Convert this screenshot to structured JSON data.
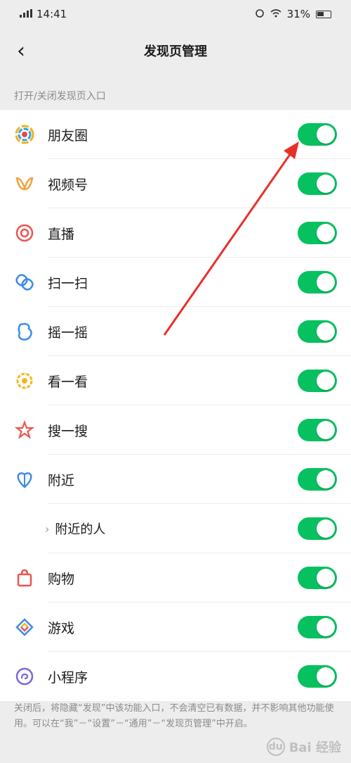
{
  "status_bar": {
    "time": "14:41",
    "battery": "31%"
  },
  "nav": {
    "back_glyph": "‹",
    "title": "发现页管理"
  },
  "caption": "打开/关闭发现页入口",
  "items": [
    {
      "label": "朋友圈",
      "icon": "moments-icon",
      "enabled": true
    },
    {
      "label": "视频号",
      "icon": "channels-icon",
      "enabled": true
    },
    {
      "label": "直播",
      "icon": "live-icon",
      "enabled": true
    },
    {
      "label": "扫一扫",
      "icon": "scan-icon",
      "enabled": true
    },
    {
      "label": "摇一摇",
      "icon": "shake-icon",
      "enabled": true
    },
    {
      "label": "看一看",
      "icon": "top-stories-icon",
      "enabled": true
    },
    {
      "label": "搜一搜",
      "icon": "search-icon",
      "enabled": true
    },
    {
      "label": "附近",
      "icon": "nearby-icon",
      "enabled": true
    },
    {
      "label": "附近的人",
      "icon": "",
      "enabled": true,
      "sub": true
    },
    {
      "label": "购物",
      "icon": "shopping-icon",
      "enabled": true
    },
    {
      "label": "游戏",
      "icon": "games-icon",
      "enabled": true
    },
    {
      "label": "小程序",
      "icon": "mini-programs-icon",
      "enabled": true
    }
  ],
  "footer_note": "关闭后，将隐藏“发现”中该功能入口，不会清空已有数据，并不影响其他功能使用。可以在“我”－“设置”－“通用”－“发现页管理”中开启。",
  "watermark": {
    "text": "Bai 经验",
    "paw": "du"
  },
  "colors": {
    "toggle_on": "#07c160",
    "annotation_arrow": "#e8302b"
  }
}
